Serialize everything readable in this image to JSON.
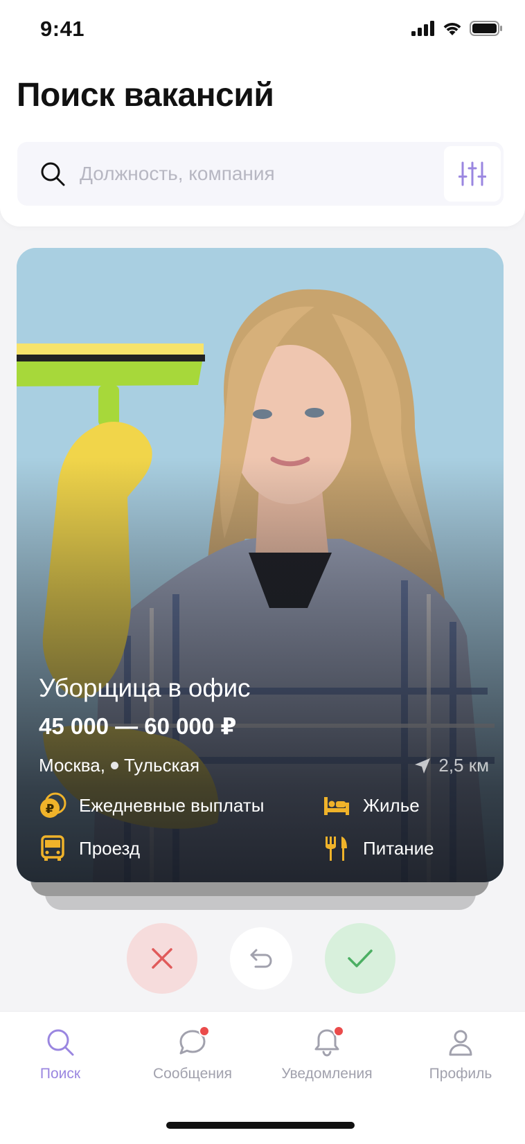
{
  "status_bar": {
    "time": "9:41"
  },
  "page_title": "Поиск вакансий",
  "search": {
    "placeholder": "Должность, компания",
    "value": ""
  },
  "job_card": {
    "title": "Уборщица в офис",
    "salary": "45 000 — 60 000 ₽",
    "city": "Москва,",
    "metro": "Тульская",
    "distance": "2,5 км",
    "perks": [
      {
        "label": "Ежедневные выплаты",
        "icon": "coin-ruble-icon"
      },
      {
        "label": "Жилье",
        "icon": "bed-icon"
      },
      {
        "label": "Проезд",
        "icon": "bus-icon"
      },
      {
        "label": "Питание",
        "icon": "fork-knife-icon"
      }
    ],
    "perk_icon_color": "#f0b32a"
  },
  "actions": {
    "reject_icon": "close-icon",
    "undo_icon": "undo-icon",
    "accept_icon": "check-icon"
  },
  "tabs": [
    {
      "label": "Поиск",
      "icon": "search-icon",
      "active": true,
      "badge": false
    },
    {
      "label": "Сообщения",
      "icon": "chat-icon",
      "active": false,
      "badge": true
    },
    {
      "label": "Уведомления",
      "icon": "bell-icon",
      "active": false,
      "badge": true
    },
    {
      "label": "Профиль",
      "icon": "user-icon",
      "active": false,
      "badge": false
    }
  ],
  "colors": {
    "accent": "#9a86e0",
    "reject": "#e05b5b",
    "accept": "#4caf63",
    "badge": "#ea4b4b"
  }
}
